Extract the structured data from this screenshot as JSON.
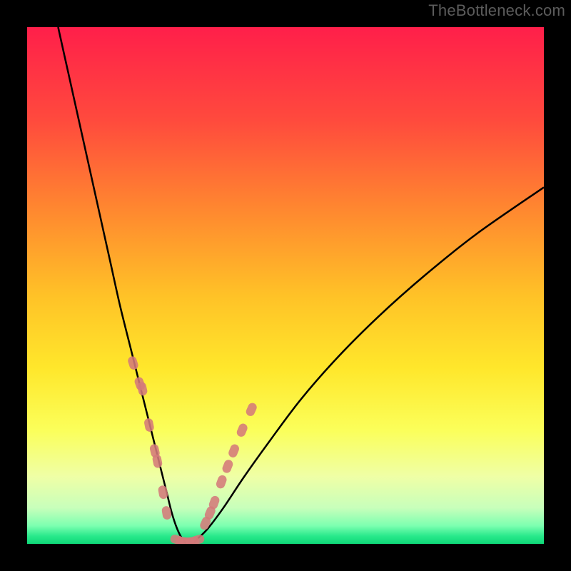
{
  "watermark": "TheBottleneck.com",
  "chart_data": {
    "type": "line",
    "title": "",
    "xlabel": "",
    "ylabel": "",
    "xlim": [
      0,
      100
    ],
    "ylim": [
      0,
      100
    ],
    "grid": false,
    "legend": false,
    "gradient_stops": [
      {
        "offset": 0.0,
        "color": "#ff1f4a"
      },
      {
        "offset": 0.18,
        "color": "#ff4a3d"
      },
      {
        "offset": 0.36,
        "color": "#ff8a2f"
      },
      {
        "offset": 0.52,
        "color": "#ffc227"
      },
      {
        "offset": 0.66,
        "color": "#ffe72b"
      },
      {
        "offset": 0.78,
        "color": "#fbff5a"
      },
      {
        "offset": 0.87,
        "color": "#efffa6"
      },
      {
        "offset": 0.93,
        "color": "#c8ffbb"
      },
      {
        "offset": 0.965,
        "color": "#7cffb0"
      },
      {
        "offset": 0.985,
        "color": "#28e98b"
      },
      {
        "offset": 1.0,
        "color": "#0fd878"
      }
    ],
    "series": [
      {
        "name": "bottleneck-curve",
        "color": "#000000",
        "x": [
          6,
          8,
          10,
          12,
          14,
          16,
          18,
          20,
          22,
          24,
          25,
          26,
          27,
          28,
          29,
          30,
          31,
          32,
          33,
          35,
          38,
          42,
          47,
          53,
          60,
          68,
          77,
          87,
          100
        ],
        "y": [
          100,
          91,
          82,
          73,
          64,
          55,
          46,
          38,
          30,
          22,
          18,
          14,
          10,
          6,
          3,
          1,
          0,
          0,
          1,
          3,
          7,
          13,
          20,
          28,
          36,
          44,
          52,
          60,
          69
        ]
      },
      {
        "name": "markers-left",
        "type": "scatter",
        "color": "#d47a7a",
        "x": [
          20.5,
          21.8,
          22.3,
          23.6,
          24.7,
          25.2,
          26.3,
          27.0
        ],
        "y": [
          35,
          31,
          30,
          23,
          18,
          16,
          10,
          6
        ]
      },
      {
        "name": "markers-bottom",
        "type": "scatter",
        "color": "#d47a7a",
        "x": [
          29.0,
          30.0,
          31.0,
          32.0,
          33.0
        ],
        "y": [
          0.8,
          0.5,
          0.4,
          0.5,
          0.8
        ]
      },
      {
        "name": "markers-right",
        "type": "scatter",
        "color": "#d47a7a",
        "x": [
          34.5,
          35.4,
          36.2,
          37.6,
          38.8,
          40.0,
          41.6,
          43.4
        ],
        "y": [
          4,
          6,
          8,
          12,
          15,
          18,
          22,
          26
        ]
      }
    ]
  }
}
